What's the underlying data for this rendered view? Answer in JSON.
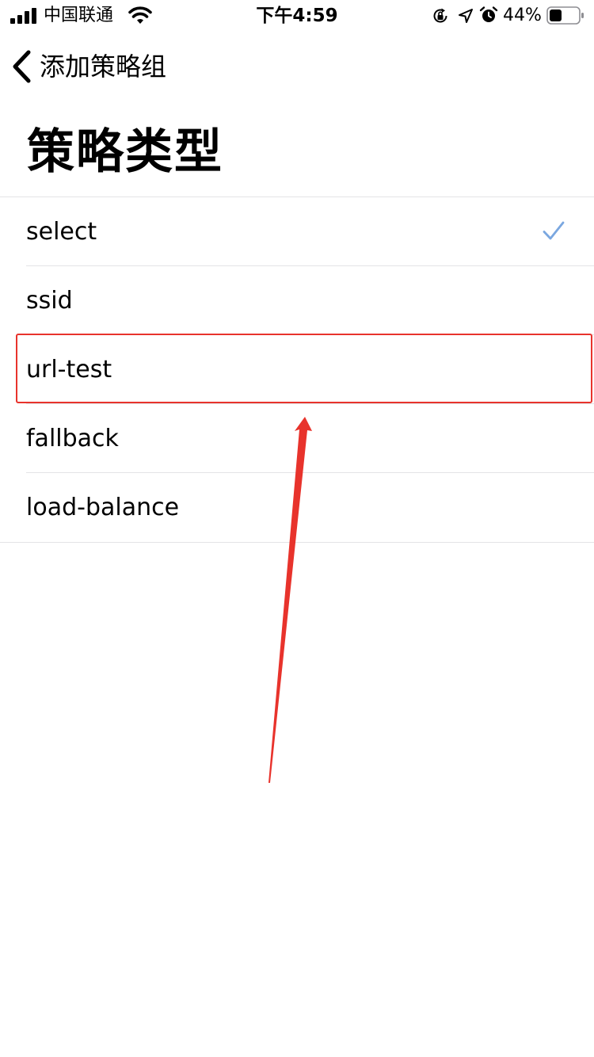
{
  "status_bar": {
    "carrier": "中国联通",
    "time": "下午4:59",
    "battery_percent": "44%",
    "battery_level": 0.44,
    "icons": [
      "signal-icon",
      "wifi-icon",
      "lock-rotation-icon",
      "location-icon",
      "alarm-icon",
      "battery-icon"
    ]
  },
  "nav": {
    "back_label": "添加策略组",
    "back_icon": "chevron-left-icon"
  },
  "page": {
    "title": "策略类型"
  },
  "options": [
    {
      "label": "select",
      "selected": true
    },
    {
      "label": "ssid",
      "selected": false
    },
    {
      "label": "url-test",
      "selected": false
    },
    {
      "label": "fallback",
      "selected": false
    },
    {
      "label": "load-balance",
      "selected": false
    }
  ],
  "annotation": {
    "highlighted_option": "url-test",
    "color": "#e8332c"
  },
  "colors": {
    "accent": "#7aa7e0",
    "separator": "#e3e3e6",
    "annotation": "#e8332c"
  }
}
